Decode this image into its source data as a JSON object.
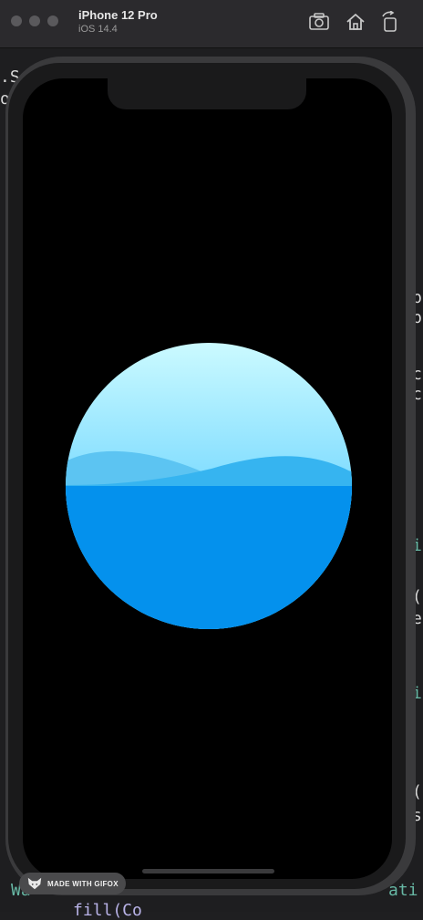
{
  "window": {
    "device_name": "iPhone 12 Pro",
    "os_version": "iOS 14.4"
  },
  "toolbar": {
    "icons": [
      "screenshot-icon",
      "home-icon",
      "rotate-icon"
    ]
  },
  "code_fragments": [
    ".S",
    "o",
    "p",
    "c",
    "c",
    "i",
    "(",
    "e",
    "i",
    "(",
    "s",
    "Wa",
    "ati",
    "fill(Co"
  ],
  "badge": {
    "text": "MADE WITH GIFOX"
  },
  "colors": {
    "sky_top": "#cbfaff",
    "sky_bottom": "#7fdcff",
    "wave_back": "#5cc4f2",
    "wave_front": "#36b4f0",
    "water": "#0491ed"
  },
  "wave": {
    "level": 0.5
  }
}
